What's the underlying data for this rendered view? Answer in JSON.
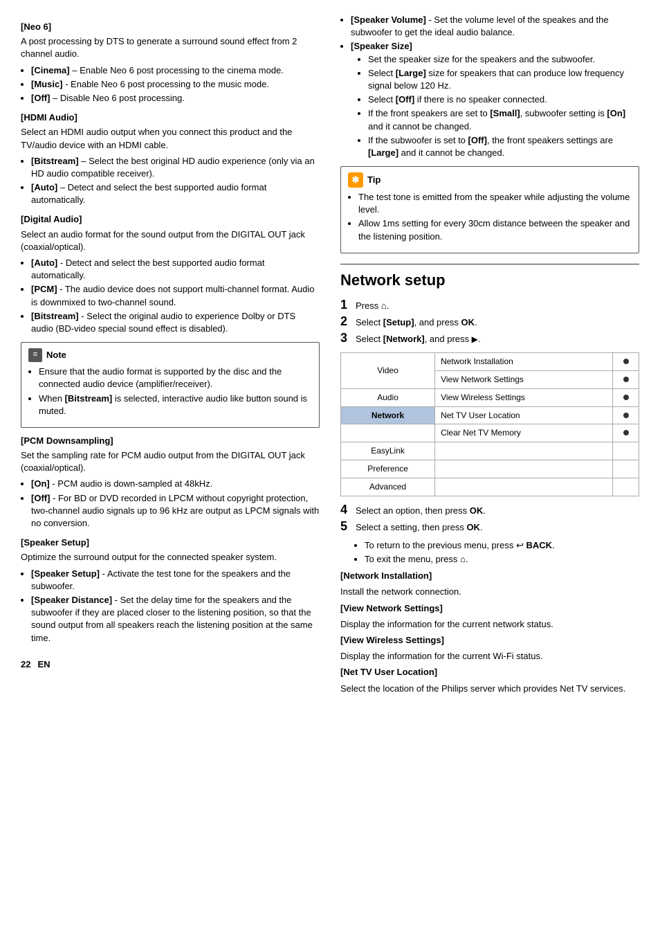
{
  "page": {
    "number": "22",
    "language": "EN"
  },
  "left_column": {
    "sections": [
      {
        "id": "neo6",
        "heading": "[Neo 6]",
        "intro": "A post processing by DTS to generate a surround sound effect from 2 channel audio.",
        "items": [
          {
            "label": "[Cinema]",
            "text": "– Enable Neo 6 post processing to the cinema mode."
          },
          {
            "label": "[Music]",
            "text": "- Enable Neo 6 post processing to the music mode."
          },
          {
            "label": "[Off]",
            "text": "– Disable Neo 6 post processing."
          }
        ]
      },
      {
        "id": "hdmi-audio",
        "heading": "[HDMI Audio]",
        "intro": "Select an HDMI audio output when you connect this product and the TV/audio device with an HDMI cable.",
        "items": [
          {
            "label": "[Bitstream]",
            "text": "– Select the best original HD audio experience (only via an HD audio compatible receiver)."
          },
          {
            "label": "[Auto]",
            "text": "– Detect and select the best supported audio format automatically."
          }
        ]
      },
      {
        "id": "digital-audio",
        "heading": "[Digital Audio]",
        "intro": "Select an audio format for the sound output from the DIGITAL OUT jack (coaxial/optical).",
        "items": [
          {
            "label": "[Auto]",
            "text": "- Detect and select the best supported audio format automatically."
          },
          {
            "label": "[PCM]",
            "text": "- The audio device does not support multi-channel format. Audio is downmixed to two-channel sound."
          },
          {
            "label": "[Bitstream]",
            "text": "- Select the original audio to experience Dolby or DTS audio (BD-video special sound effect is disabled)."
          }
        ]
      },
      {
        "id": "note1",
        "type": "note",
        "header": "Note",
        "items": [
          "Ensure that the audio format is supported by the disc and the connected audio device (amplifier/receiver).",
          "When [Bitstream] is selected, interactive audio like button sound is muted."
        ]
      },
      {
        "id": "pcm-downsampling",
        "heading": "[PCM Downsampling]",
        "intro": "Set the sampling rate for PCM audio output from the DIGITAL OUT jack (coaxial/optical).",
        "items": [
          {
            "label": "[On]",
            "text": "- PCM audio is down-sampled at 48kHz."
          },
          {
            "label": "[Off]",
            "text": "- For BD or DVD recorded in LPCM without copyright protection, two-channel audio signals up to 96 kHz are output as LPCM signals with no conversion."
          }
        ]
      },
      {
        "id": "speaker-setup",
        "heading": "[Speaker Setup]",
        "intro": "Optimize the surround output for the connected speaker system.",
        "items": [
          {
            "label": "[Speaker Setup]",
            "text": "- Activate the test tone for the speakers and the subwoofer."
          },
          {
            "label": "[Speaker Distance]",
            "text": "- Set the delay time for the speakers and the subwoofer if they are placed closer to the listening position, so that the sound output from all speakers reach the listening position at the same time."
          }
        ]
      }
    ]
  },
  "right_column": {
    "speaker_items": [
      {
        "label": "[Speaker Volume]",
        "text": "- Set the volume level of the speakes and the subwoofer to get the ideal audio balance."
      },
      {
        "label": "[Speaker Size]",
        "type": "heading_only"
      },
      {
        "text": "Set the speaker size for the speakers and the subwoofer."
      },
      {
        "text": "Select [Large] size for speakers that can produce low frequency signal below 120 Hz."
      },
      {
        "text": "Select [Off] if there is no speaker connected."
      },
      {
        "text": "If the front speakers are set to [Small], subwoofer setting is [On] and it cannot be changed."
      },
      {
        "text": "If the subwoofer is set to [Off], the front speakers settings are [Large] and it cannot be changed."
      }
    ],
    "tip": {
      "header": "Tip",
      "items": [
        "The test tone is emitted from the speaker while adjusting the volume level.",
        "Allow 1ms setting for every 30cm distance between the speaker and the listening position."
      ]
    },
    "network_setup": {
      "title": "Network setup",
      "steps": [
        {
          "num": "1",
          "text": "Press ⌂."
        },
        {
          "num": "2",
          "text": "Select [Setup], and press OK."
        },
        {
          "num": "3",
          "text": "Select [Network], and press ▶."
        }
      ],
      "menu_table": {
        "rows": [
          {
            "menu": "Video",
            "option": "Network Installation",
            "dot": true,
            "highlighted": false
          },
          {
            "menu": "",
            "option": "View Network Settings",
            "dot": true,
            "highlighted": false
          },
          {
            "menu": "Audio",
            "option": "View Wireless Settings",
            "dot": true,
            "highlighted": false
          },
          {
            "menu": "Network",
            "option": "Net TV User Location",
            "dot": true,
            "highlighted": true
          },
          {
            "menu": "",
            "option": "Clear Net TV Memory",
            "dot": true,
            "highlighted": false
          },
          {
            "menu": "EasyLink",
            "option": "",
            "dot": false,
            "highlighted": false
          },
          {
            "menu": "Preference",
            "option": "",
            "dot": false,
            "highlighted": false
          },
          {
            "menu": "Advanced",
            "option": "",
            "dot": false,
            "highlighted": false
          }
        ]
      },
      "steps2": [
        {
          "num": "4",
          "text": "Select an option, then press OK."
        },
        {
          "num": "5",
          "text": "Select a setting, then press OK."
        }
      ],
      "sub_steps": [
        "To return to the previous menu, press ↩ BACK.",
        "To exit the menu, press ⌂."
      ],
      "descriptions": [
        {
          "label": "[Network Installation]",
          "text": "Install the network connection."
        },
        {
          "label": "[View Network Settings]",
          "text": "Display the information for the current network status."
        },
        {
          "label": "[View Wireless Settings]",
          "text": "Display the information for the current Wi-Fi status."
        },
        {
          "label": "[Net TV User Location]",
          "text": "Select the location of the Philips server which provides Net TV services."
        }
      ]
    }
  }
}
